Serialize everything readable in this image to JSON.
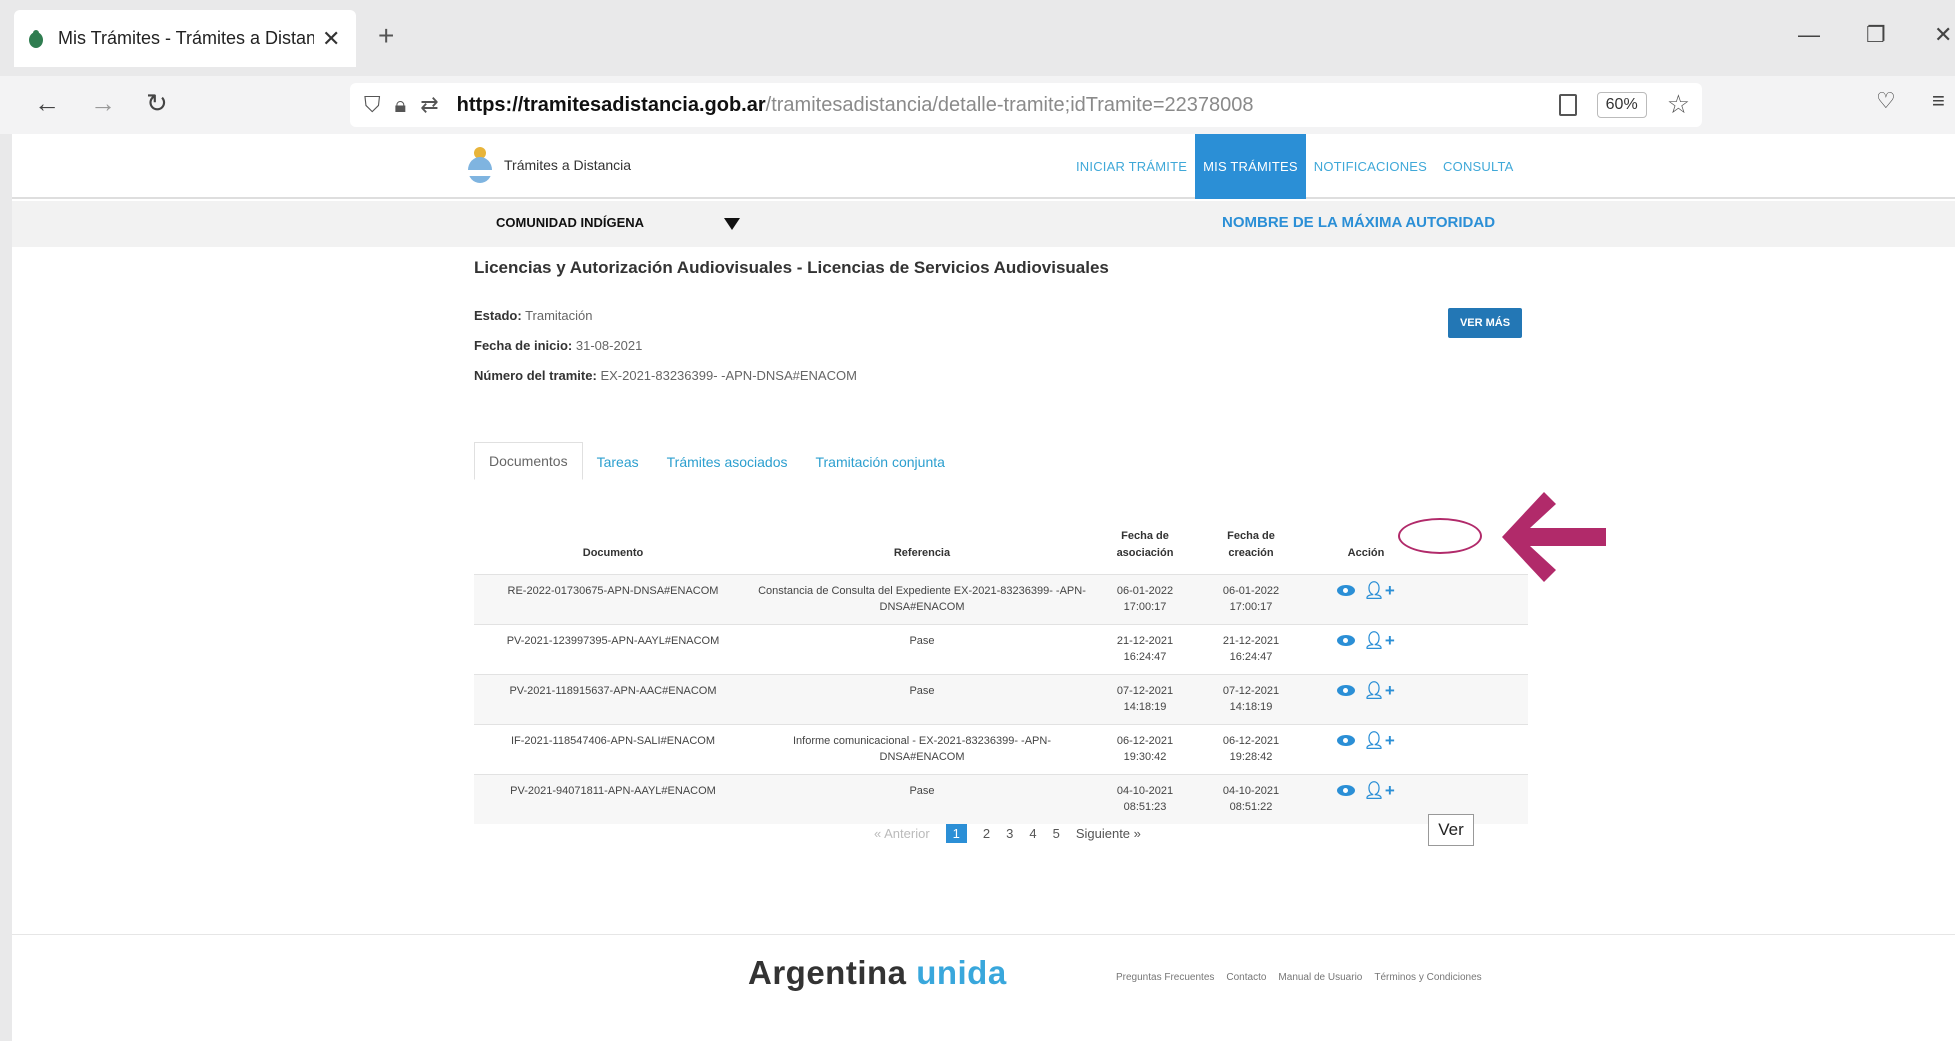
{
  "browser": {
    "tab_title": "Mis Trámites - Trámites a Distan",
    "url_host": "https://tramitesadistancia.gob.ar",
    "url_path": "/tramitesadistancia/detalle-tramite;idTramite=22378008",
    "zoom": "60%"
  },
  "site": {
    "logo_text": "Trámites a Distancia",
    "nav": [
      "INICIAR TRÁMITE",
      "MIS TRÁMITES",
      "NOTIFICACIONES",
      "CONSULTA"
    ],
    "nav_active_index": 1,
    "community_select": "COMUNIDAD INDÍGENA",
    "authority_label": "NOMBRE DE LA MÁXIMA AUTORIDAD"
  },
  "tramite": {
    "title": "Licencias y Autorización Audiovisuales - Licencias de Servicios Audiovisuales",
    "estado_label": "Estado:",
    "estado_value": "Tramitación",
    "fecha_label": "Fecha de inicio:",
    "fecha_value": "31-08-2021",
    "numero_label": "Número del tramite:",
    "numero_value": "EX-2021-83236399- -APN-DNSA#ENACOM",
    "ver_mas": "VER MÁS"
  },
  "tabs": [
    "Documentos",
    "Tareas",
    "Trámites asociados",
    "Tramitación conjunta"
  ],
  "table": {
    "headers": {
      "documento": "Documento",
      "referencia": "Referencia",
      "fecha_asociacion_1": "Fecha de",
      "fecha_asociacion_2": "asociación",
      "fecha_creacion_1": "Fecha de",
      "fecha_creacion_2": "creación",
      "accion": "Acción"
    },
    "rows": [
      {
        "documento": "RE-2022-01730675-APN-DNSA#ENACOM",
        "referencia": "Constancia de Consulta del Expediente EX-2021-83236399- -APN-DNSA#ENACOM",
        "asoc_fecha": "06-01-2022",
        "asoc_hora": "17:00:17",
        "crea_fecha": "06-01-2022",
        "crea_hora": "17:00:17"
      },
      {
        "documento": "PV-2021-123997395-APN-AAYL#ENACOM",
        "referencia": "Pase",
        "asoc_fecha": "21-12-2021",
        "asoc_hora": "16:24:47",
        "crea_fecha": "21-12-2021",
        "crea_hora": "16:24:47"
      },
      {
        "documento": "PV-2021-118915637-APN-AAC#ENACOM",
        "referencia": "Pase",
        "asoc_fecha": "07-12-2021",
        "asoc_hora": "14:18:19",
        "crea_fecha": "07-12-2021",
        "crea_hora": "14:18:19"
      },
      {
        "documento": "IF-2021-118547406-APN-SALI#ENACOM",
        "referencia": "Informe comunicacional - EX-2021-83236399- -APN-DNSA#ENACOM",
        "asoc_fecha": "06-12-2021",
        "asoc_hora": "19:30:42",
        "crea_fecha": "06-12-2021",
        "crea_hora": "19:28:42"
      },
      {
        "documento": "PV-2021-94071811-APN-AAYL#ENACOM",
        "referencia": "Pase",
        "asoc_fecha": "04-10-2021",
        "asoc_hora": "08:51:23",
        "crea_fecha": "04-10-2021",
        "crea_hora": "08:51:22"
      }
    ]
  },
  "pager": {
    "prev": "« Anterior",
    "pages": [
      "1",
      "2",
      "3",
      "4",
      "5"
    ],
    "current": "1",
    "next": "Siguiente »"
  },
  "ver_label": "Ver",
  "footer": {
    "brand_1": "Argentina",
    "brand_2": "unida",
    "links": [
      "Preguntas Frecuentes",
      "Contacto",
      "Manual de Usuario",
      "Términos y Condiciones"
    ]
  },
  "colors": {
    "accent": "#2b8fd6",
    "annotation": "#b12a6a",
    "button": "#2377b5"
  }
}
